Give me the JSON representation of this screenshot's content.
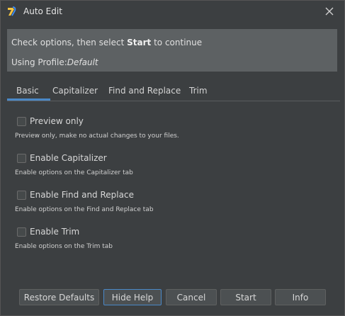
{
  "window": {
    "title": "Auto Edit",
    "icon": "app-logo-icon"
  },
  "header": {
    "instruction_prefix": "Check options, then select ",
    "instruction_bold": "Start",
    "instruction_suffix": " to continue",
    "profile_label": "Using Profile:",
    "profile_value": "Default"
  },
  "tabs": [
    {
      "label": "Basic",
      "active": true
    },
    {
      "label": "Capitalizer",
      "active": false
    },
    {
      "label": "Find and Replace",
      "active": false
    },
    {
      "label": "Trim",
      "active": false
    }
  ],
  "options": [
    {
      "label": "Preview only",
      "checked": false,
      "help": "Preview only, make no actual changes to your files."
    },
    {
      "label": "Enable Capitalizer",
      "checked": false,
      "help": "Enable options on the Capitalizer tab"
    },
    {
      "label": "Enable Find and Replace",
      "checked": false,
      "help": "Enable options on the Find and Replace tab"
    },
    {
      "label": "Enable Trim",
      "checked": false,
      "help": "Enable options on the Trim tab"
    }
  ],
  "buttons": {
    "restore_defaults": "Restore Defaults",
    "hide_help": "Hide Help",
    "cancel": "Cancel",
    "start": "Start",
    "info": "Info"
  },
  "colors": {
    "background": "#3c3f41",
    "header_bg": "#5d6163",
    "accent": "#4a88c7"
  }
}
